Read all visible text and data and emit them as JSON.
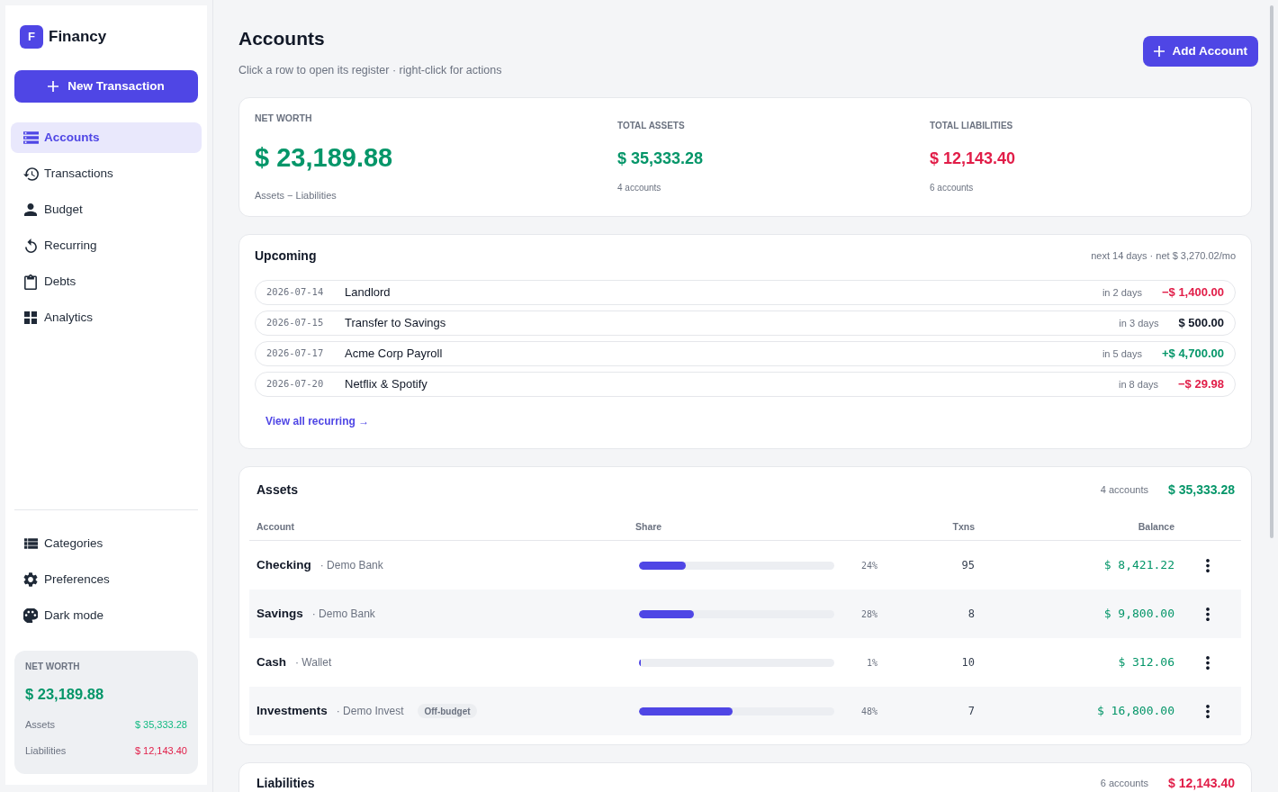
{
  "sidebar": {
    "logo": {
      "mark": "F",
      "name": "Financy"
    },
    "new_transaction_button": "New Transaction",
    "nav": [
      {
        "label": "Accounts",
        "selected": true
      },
      {
        "label": "Transactions",
        "selected": false
      },
      {
        "label": "Budget",
        "selected": false
      },
      {
        "label": "Recurring",
        "selected": false
      },
      {
        "label": "Debts",
        "selected": false
      },
      {
        "label": "Analytics",
        "selected": false
      }
    ],
    "secondary_nav": [
      {
        "label": "Categories",
        "selected": false
      },
      {
        "label": "Preferences",
        "selected": false
      },
      {
        "label": "Dark mode",
        "selected": false
      }
    ],
    "net_worth": {
      "title": "NET WORTH",
      "value": "$ 23,189.88",
      "rows": [
        {
          "label": "Assets",
          "value": "$ 35,333.28",
          "kind": "asset"
        },
        {
          "label": "Liabilities",
          "value": "$ 12,143.40",
          "kind": "liability"
        }
      ]
    }
  },
  "header": {
    "title": "Accounts",
    "subtitle": "Click a row to open its register · right-click for actions",
    "add_button": "Add Account"
  },
  "summary": {
    "net_worth": {
      "label": "NET WORTH",
      "value": "$ 23,189.88",
      "note": "Assets − Liabilities"
    },
    "total_assets": {
      "label": "TOTAL ASSETS",
      "value": "$ 35,333.28",
      "note": "4 accounts"
    },
    "total_liabilities": {
      "label": "TOTAL LIABILITIES",
      "value": "$ 12,143.40",
      "note": "6 accounts"
    }
  },
  "upcoming": {
    "title": "Upcoming",
    "meta": "next 14 days · net $ 3,270.02/mo",
    "items": [
      {
        "date": "2026-07-14",
        "name": "Landlord",
        "due": "in 2 days",
        "amount": "−$ 1,400.00",
        "kind": "expense"
      },
      {
        "date": "2026-07-15",
        "name": "Transfer to Savings",
        "due": "in 3 days",
        "amount": "$ 500.00",
        "kind": "transfer"
      },
      {
        "date": "2026-07-17",
        "name": "Acme Corp Payroll",
        "due": "in 5 days",
        "amount": "+$ 4,700.00",
        "kind": "income"
      },
      {
        "date": "2026-07-20",
        "name": "Netflix & Spotify",
        "due": "in 8 days",
        "amount": "−$ 29.98",
        "kind": "expense"
      }
    ],
    "link": "View all recurring →"
  },
  "assets": {
    "title": "Assets",
    "count": "4 accounts",
    "total": "$ 35,333.28",
    "columns": [
      "Account",
      "Share",
      "Txns",
      "Balance"
    ],
    "rows": [
      {
        "name": "Checking",
        "institution": "· Demo Bank",
        "level": 0.24,
        "share": "24%",
        "txns": "95",
        "balance": "$ 8,421.22"
      },
      {
        "name": "Savings",
        "institution": "· Demo Bank",
        "level": 0.28,
        "share": "28%",
        "txns": "8",
        "balance": "$ 9,800.00"
      },
      {
        "name": "Cash",
        "institution": "· Wallet",
        "level": 0.01,
        "share": "1%",
        "txns": "10",
        "balance": "$ 312.06"
      },
      {
        "name": "Investments",
        "institution": "· Demo Invest",
        "tag": "Off-budget",
        "level": 0.48,
        "share": "48%",
        "txns": "7",
        "balance": "$ 16,800.00"
      }
    ]
  },
  "liabilities": {
    "title": "Liabilities",
    "count": "6 accounts",
    "total": "$ 12,143.40"
  }
}
